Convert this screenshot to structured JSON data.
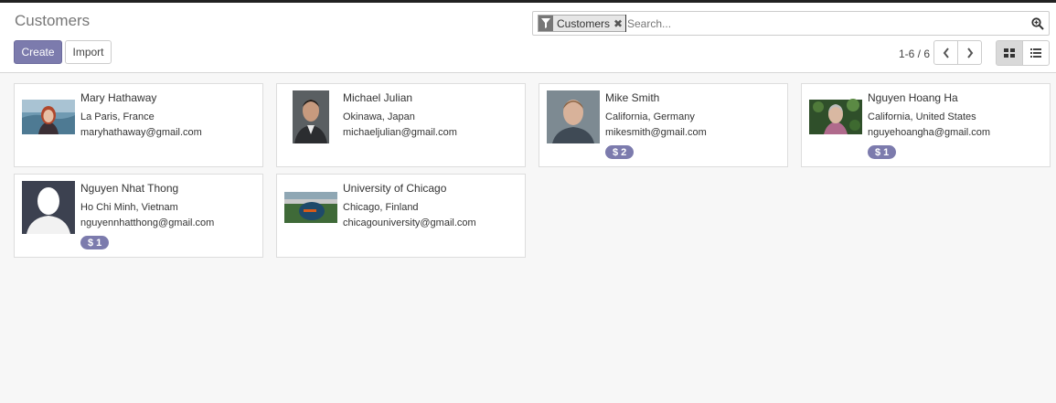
{
  "header": {
    "title": "Customers",
    "create_label": "Create",
    "import_label": "Import"
  },
  "search": {
    "facet_label": "Customers",
    "placeholder": "Search..."
  },
  "pager": {
    "value": "1-6 / 6"
  },
  "colors": {
    "accent": "#7c7bad"
  },
  "customers": [
    {
      "name": "Mary Hathaway",
      "location": "La Paris, France",
      "email": "maryhathaway@gmail.com",
      "badge": ""
    },
    {
      "name": "Michael Julian",
      "location": "Okinawa, Japan",
      "email": "michaeljulian@gmail.com",
      "badge": ""
    },
    {
      "name": "Mike Smith",
      "location": "California, Germany",
      "email": "mikesmith@gmail.com",
      "badge": "$ 2"
    },
    {
      "name": "Nguyen Hoang Ha",
      "location": "California, United States",
      "email": "nguyehoangha@gmail.com",
      "badge": "$ 1"
    },
    {
      "name": "Nguyen Nhat Thong",
      "location": "Ho Chi Minh, Vietnam",
      "email": "nguyennhatthong@gmail.com",
      "badge": "$ 1"
    },
    {
      "name": "University of Chicago",
      "location": "Chicago, Finland",
      "email": "chicagouniversity@gmail.com",
      "badge": ""
    }
  ]
}
